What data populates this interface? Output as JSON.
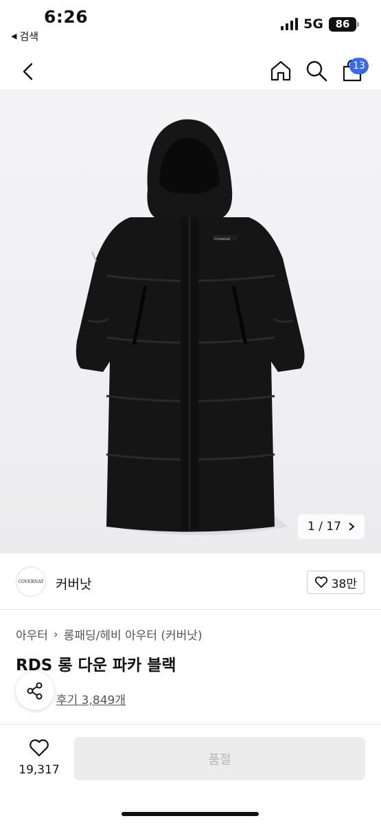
{
  "status_bar": {
    "time": "6:26",
    "back_to_app": "검색",
    "network": "5G",
    "battery": "86"
  },
  "nav": {
    "cart_count": "13"
  },
  "gallery": {
    "current_page": "1",
    "total_pages": "17",
    "counter_separator": "/"
  },
  "brand": {
    "logo_text": "COVERNAT",
    "name": "커버낫",
    "likes": "38만"
  },
  "product": {
    "breadcrumb": [
      "아우터",
      "롱패딩/헤비 아우터 (커버낫)"
    ],
    "title": "RDS 롱 다운 파카 블랙",
    "review_link": "후기 3,849개"
  },
  "bottom_bar": {
    "wish_count": "19,317",
    "buy_button": "품절"
  },
  "colors": {
    "badge": "#3a6ae6",
    "jacket": "#141414",
    "disabled_button": "#ececec",
    "disabled_text": "#b5b5b5"
  }
}
